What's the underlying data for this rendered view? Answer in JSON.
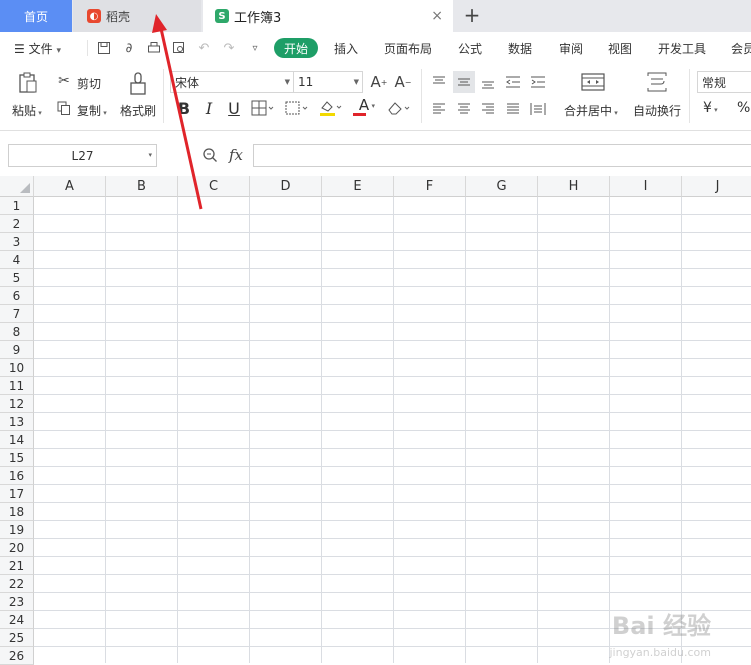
{
  "tabs": {
    "home": "首页",
    "docer": "稻壳",
    "workbook": "工作簿3",
    "workbook_icon": "S",
    "close": "×",
    "add": "+"
  },
  "menu": {
    "file": "文件",
    "items": [
      "开始",
      "插入",
      "页面布局",
      "公式",
      "数据",
      "审阅",
      "视图",
      "开发工具",
      "会员"
    ]
  },
  "ribbon": {
    "paste": "粘贴",
    "cut": "剪切",
    "copy": "复制",
    "format_painter": "格式刷",
    "font_name": "宋体",
    "font_size": "11",
    "bold": "B",
    "italic": "I",
    "underline": "U",
    "font_color": "A",
    "merge_center": "合并居中",
    "wrap_text": "自动换行",
    "number_format": "常规",
    "currency": "¥",
    "percent": "%"
  },
  "formula_bar": {
    "cell_ref": "L27",
    "fx": "fx",
    "formula": ""
  },
  "columns": [
    "A",
    "B",
    "C",
    "D",
    "E",
    "F",
    "G",
    "H",
    "I",
    "J"
  ],
  "rows": [
    "1",
    "2",
    "3",
    "4",
    "5",
    "6",
    "7",
    "8",
    "9",
    "10",
    "11",
    "12",
    "13",
    "14",
    "15",
    "16",
    "17",
    "18",
    "19",
    "20",
    "21",
    "22",
    "23",
    "24",
    "25",
    "26"
  ],
  "watermark": {
    "text": "Bai 经验",
    "sub": "jingyan.baidu.com"
  },
  "colors": {
    "home_tab": "#5b8ef4",
    "start_button": "#1e9e67",
    "annotation_arrow": "#e0242a"
  }
}
